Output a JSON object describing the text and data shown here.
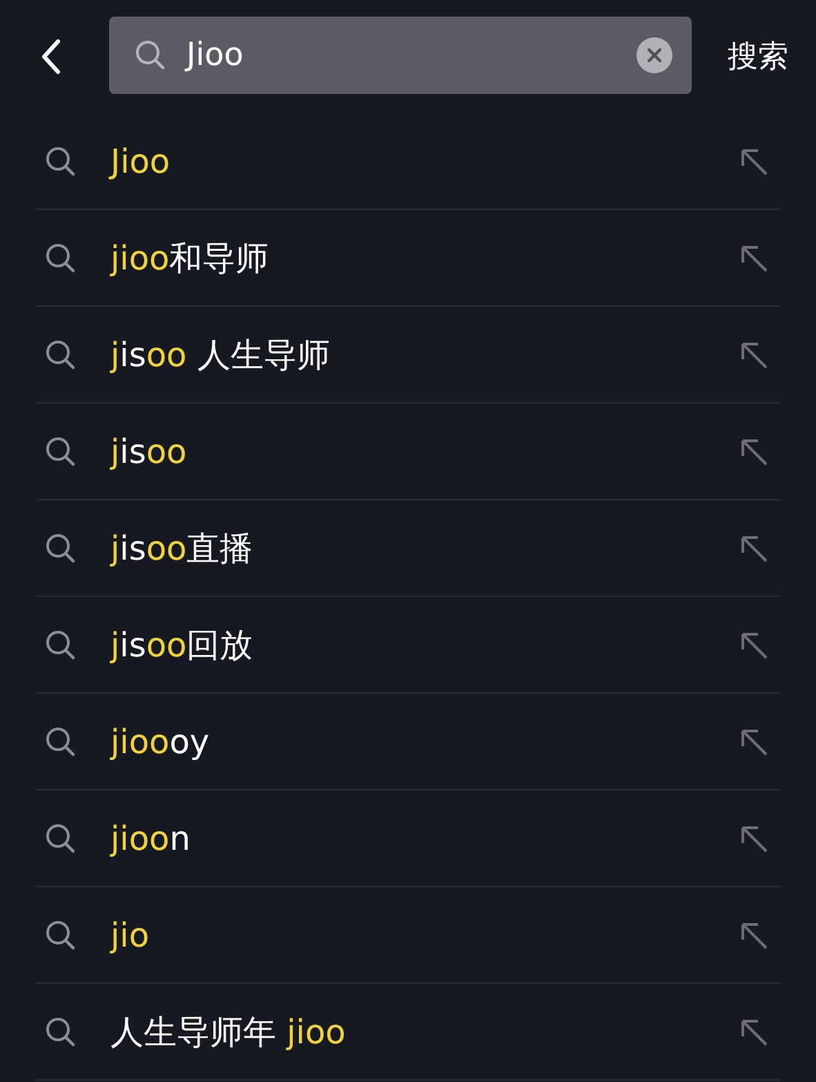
{
  "search": {
    "value": "Jioo",
    "action": "搜索"
  },
  "suggestions": [
    {
      "parts": [
        {
          "text": "Jioo",
          "match": true
        }
      ]
    },
    {
      "parts": [
        {
          "text": "jioo",
          "match": true
        },
        {
          "text": "和导师",
          "match": false
        }
      ]
    },
    {
      "parts": [
        {
          "text": "j",
          "match": true
        },
        {
          "text": "is",
          "match": false
        },
        {
          "text": "oo",
          "match": true
        },
        {
          "text": " 人生导师",
          "match": false
        }
      ]
    },
    {
      "parts": [
        {
          "text": "j",
          "match": true
        },
        {
          "text": "is",
          "match": false
        },
        {
          "text": "oo",
          "match": true
        }
      ]
    },
    {
      "parts": [
        {
          "text": "j",
          "match": true
        },
        {
          "text": "is",
          "match": false
        },
        {
          "text": "oo",
          "match": true
        },
        {
          "text": "直播",
          "match": false
        }
      ]
    },
    {
      "parts": [
        {
          "text": "j",
          "match": true
        },
        {
          "text": "is",
          "match": false
        },
        {
          "text": "oo",
          "match": true
        },
        {
          "text": "回放",
          "match": false
        }
      ]
    },
    {
      "parts": [
        {
          "text": "jioo",
          "match": true
        },
        {
          "text": "oy",
          "match": false
        }
      ]
    },
    {
      "parts": [
        {
          "text": "jioo",
          "match": true
        },
        {
          "text": "n",
          "match": false
        }
      ]
    },
    {
      "parts": [
        {
          "text": "jio",
          "match": true
        }
      ]
    },
    {
      "parts": [
        {
          "text": "人生导师年 ",
          "match": false
        },
        {
          "text": "jioo",
          "match": true
        }
      ]
    }
  ]
}
